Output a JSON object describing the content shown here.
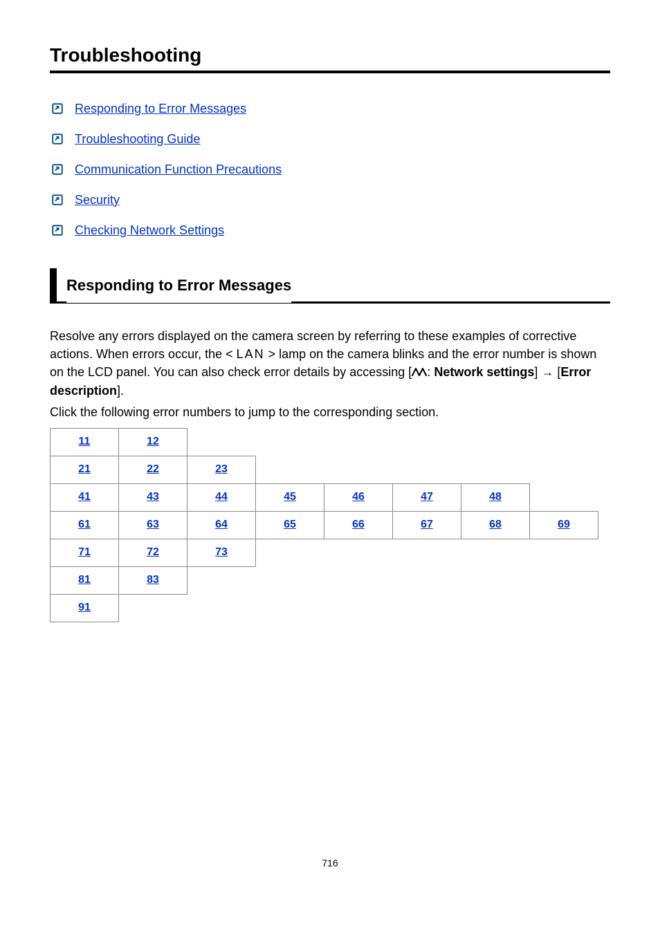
{
  "title": "Troubleshooting",
  "links": [
    {
      "label": "Responding to Error Messages"
    },
    {
      "label": "Troubleshooting Guide"
    },
    {
      "label": "Communication Function Precautions"
    },
    {
      "label": "Security"
    },
    {
      "label": "Checking Network Settings"
    }
  ],
  "section": {
    "heading": "Responding to Error Messages",
    "para1_a": "Resolve any errors displayed on the camera screen by referring to these examples of corrective actions. When errors occur, the < ",
    "lan": "LAN",
    "para1_b": " > lamp on the camera blinks and the error number is shown on the LCD panel. You can also check error details by accessing [",
    "net_settings": "Network settings",
    "para1_c": "] → [",
    "err_desc": "Error description",
    "para1_d": "].",
    "para2": "Click the following error numbers to jump to the corresponding section."
  },
  "table": [
    [
      "11",
      "12",
      "",
      "",
      "",
      "",
      "",
      ""
    ],
    [
      "21",
      "22",
      "23",
      "",
      "",
      "",
      "",
      ""
    ],
    [
      "41",
      "43",
      "44",
      "45",
      "46",
      "47",
      "48",
      ""
    ],
    [
      "61",
      "63",
      "64",
      "65",
      "66",
      "67",
      "68",
      "69"
    ],
    [
      "71",
      "72",
      "73",
      "",
      "",
      "",
      "",
      ""
    ],
    [
      "81",
      "83",
      "",
      "",
      "",
      "",
      "",
      ""
    ],
    [
      "91",
      "",
      "",
      "",
      "",
      "",
      "",
      ""
    ]
  ],
  "page_number": "716",
  "colon": ": "
}
